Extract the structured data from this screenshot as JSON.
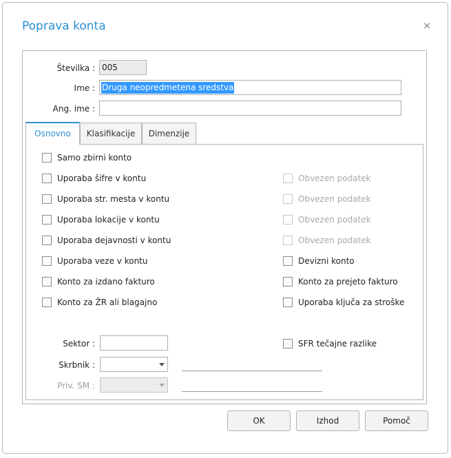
{
  "dialog": {
    "title": "Poprava konta",
    "close_glyph": "×"
  },
  "header": {
    "stevilka_label": "Številka :",
    "stevilka_value": "005",
    "ime_label": "Ime :",
    "ime_value": "Druga neopredmetena sredstva",
    "ang_ime_label": "Ang. ime :",
    "ang_ime_value": ""
  },
  "tabs": [
    {
      "label": "Osnovno",
      "active": true
    },
    {
      "label": "Klasifikacije",
      "active": false
    },
    {
      "label": "Dimenzije",
      "active": false
    }
  ],
  "left_checks": [
    {
      "label": "Samo zbirni konto",
      "checked": false
    },
    {
      "label": "Uporaba šifre v kontu",
      "checked": false
    },
    {
      "label": "Uporaba str. mesta v kontu",
      "checked": false
    },
    {
      "label": "Uporaba lokacije v kontu",
      "checked": false
    },
    {
      "label": "Uporaba dejavnosti v kontu",
      "checked": false
    },
    {
      "label": "Uporaba veze v kontu",
      "checked": false
    },
    {
      "label": "Konto za izdano fakturo",
      "checked": false
    },
    {
      "label": "Konto za ŽR ali blagajno",
      "checked": false
    }
  ],
  "right_checks": [
    {
      "label": "Obvezen podatek",
      "disabled": true
    },
    {
      "label": "Obvezen podatek",
      "disabled": true
    },
    {
      "label": "Obvezen podatek",
      "disabled": true
    },
    {
      "label": "Obvezen podatek",
      "disabled": true
    },
    {
      "label": "Devizni konto",
      "disabled": false
    },
    {
      "label": "Konto za prejeto fakturo",
      "disabled": false
    },
    {
      "label": "Uporaba ključa za stroške",
      "disabled": false
    },
    {
      "label": "SFR tečajne razlike",
      "disabled": false
    }
  ],
  "bottom": {
    "sektor_label": "Sektor :",
    "sektor_value": "",
    "skrbnik_label": "Skrbnik :",
    "skrbnik_value": "",
    "priv_sm_label": "Priv. SM :",
    "priv_sm_value": ""
  },
  "buttons": {
    "ok": "OK",
    "izhod": "Izhod",
    "pomoc": "Pomoč"
  },
  "colors": {
    "accent": "#2a8fd0",
    "selection": "#3399ff"
  }
}
